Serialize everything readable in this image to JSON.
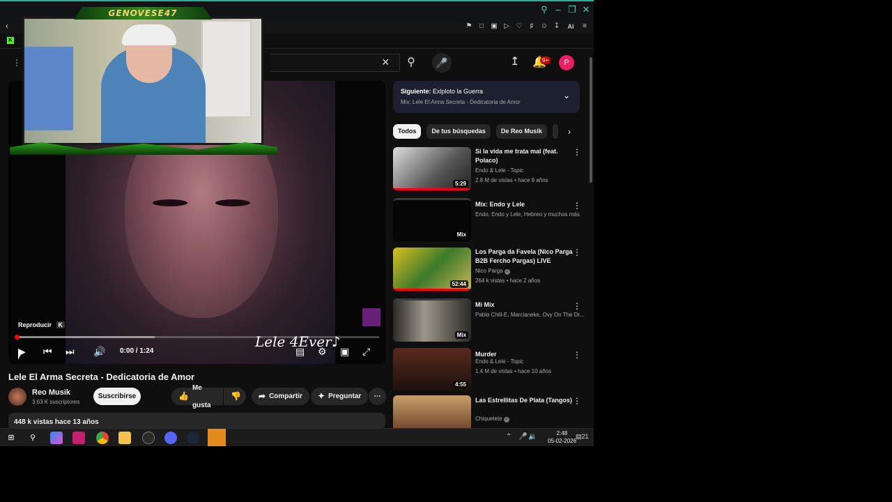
{
  "browser": {
    "extensions_ai_label": "AI"
  },
  "header": {
    "notification_count": "9+",
    "avatar_letter": "P"
  },
  "stream_overlay": {
    "streamer_name": "GENOVESE47"
  },
  "player": {
    "overlay_text": "Lele 4Ever♪",
    "tooltip_label": "Reproducir",
    "tooltip_key": "K",
    "time": "0:00 / 1:24",
    "progress_buffered_fraction": 0.38
  },
  "video": {
    "title": "Lele El Arma Secreta - Dedicatoria de Amor",
    "channel": "Reo Musik",
    "subscribers": "3.63 K suscriptores",
    "subscribe_label": "Suscribirse",
    "like_label": "Me gusta",
    "share_label": "Compartir",
    "ask_label": "Preguntar",
    "views": "448 k vistas  hace 13 años"
  },
  "up_next": {
    "label": "Siguiente:",
    "title": "Exlploto la Guerra",
    "subtitle": "Mix: Lele El Arma Secreta - Dedicatoria de Amor"
  },
  "chips": [
    "Todos",
    "De tus búsquedas",
    "De Reo Musik"
  ],
  "recommendations": [
    {
      "title": "Si la vida me trata mal (feat. Polaco)",
      "channel": "Endo & Lele - Topic",
      "meta": "2.8 M de vistas • hace 9 años",
      "duration": "5:29"
    },
    {
      "title": "Mix: Endo y Lele",
      "channel": "Endo, Endo y Lele, Hebreo y muchos más",
      "meta": "",
      "duration": "Mix"
    },
    {
      "title": "Los Parga da Favela (Nico Parga B2B Fercho Pargas) LIVE",
      "channel": "Nico Parga",
      "meta": "264 k vistas • hace 2 años",
      "duration": "52:44"
    },
    {
      "title": "Mi Mix",
      "channel": "Pablo Chill-E, Marcianeke, Ovy On The Dr...",
      "meta": "",
      "duration": "Mix"
    },
    {
      "title": "Murder",
      "channel": "Endo & Lele - Topic",
      "meta": "1.4 M de vistas • hace 10 años",
      "duration": "4:55"
    },
    {
      "title": "Las Estrellitas De Plata (Tangos)",
      "channel": "Chiquetete",
      "meta": "",
      "duration": ""
    }
  ],
  "taskbar": {
    "time": "2:48",
    "date": "05-02-2026",
    "notif": "21"
  },
  "colors": {
    "accent": "#ff0000",
    "bg": "#0f0f0f",
    "teal": "#1fb89a"
  }
}
